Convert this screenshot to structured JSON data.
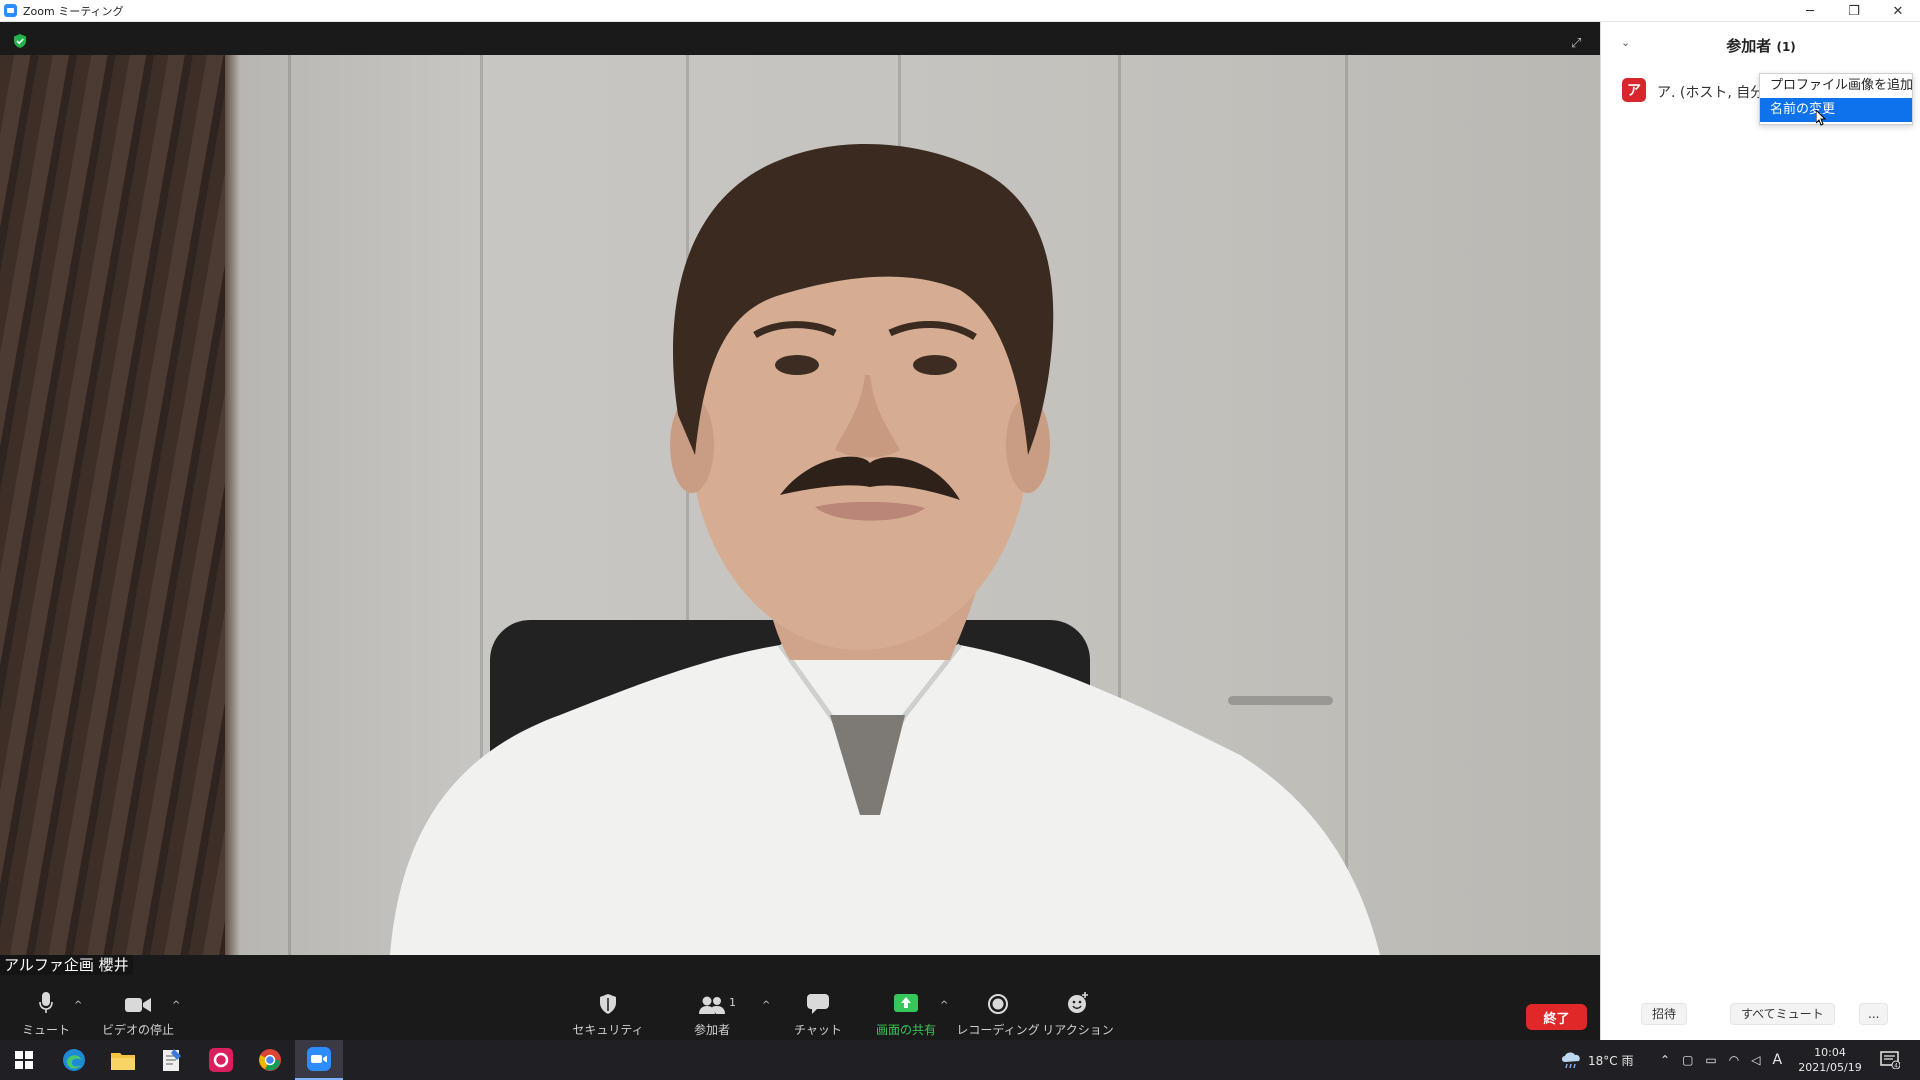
{
  "window": {
    "title": "Zoom ミーティング",
    "min_glyph": "─",
    "restore_glyph": "❐",
    "close_glyph": "✕"
  },
  "video": {
    "name_tag": "アルファ企画 櫻井",
    "expand_glyph": "⤢"
  },
  "toolbar": {
    "mute": "ミュート",
    "video_stop": "ビデオの停止",
    "security": "セキュリティ",
    "participants": "参加者",
    "participants_count": "1",
    "chat": "チャット",
    "share_screen": "画面の共有",
    "recording": "レコーディング",
    "reactions": "リアクション",
    "end": "終了",
    "caret": "^",
    "share_color": "#35c759",
    "end_color": "#e02828"
  },
  "panel": {
    "title": "参加者",
    "count": "(1)",
    "collapse_glyph": "⌄",
    "participant": {
      "avatar_letter": "ア",
      "name": "ア. (ホスト, 自分)"
    },
    "context_menu": [
      {
        "label": "プロファイル画像を追加"
      },
      {
        "label": "名前の変更"
      }
    ],
    "footer": {
      "invite": "招待",
      "mute_all": "すべてミュート",
      "more": "..."
    }
  },
  "taskbar": {
    "weather": "18°C 雨",
    "time": "10:04",
    "date": "2021/05/19",
    "ime": "A",
    "notifications": "4"
  }
}
